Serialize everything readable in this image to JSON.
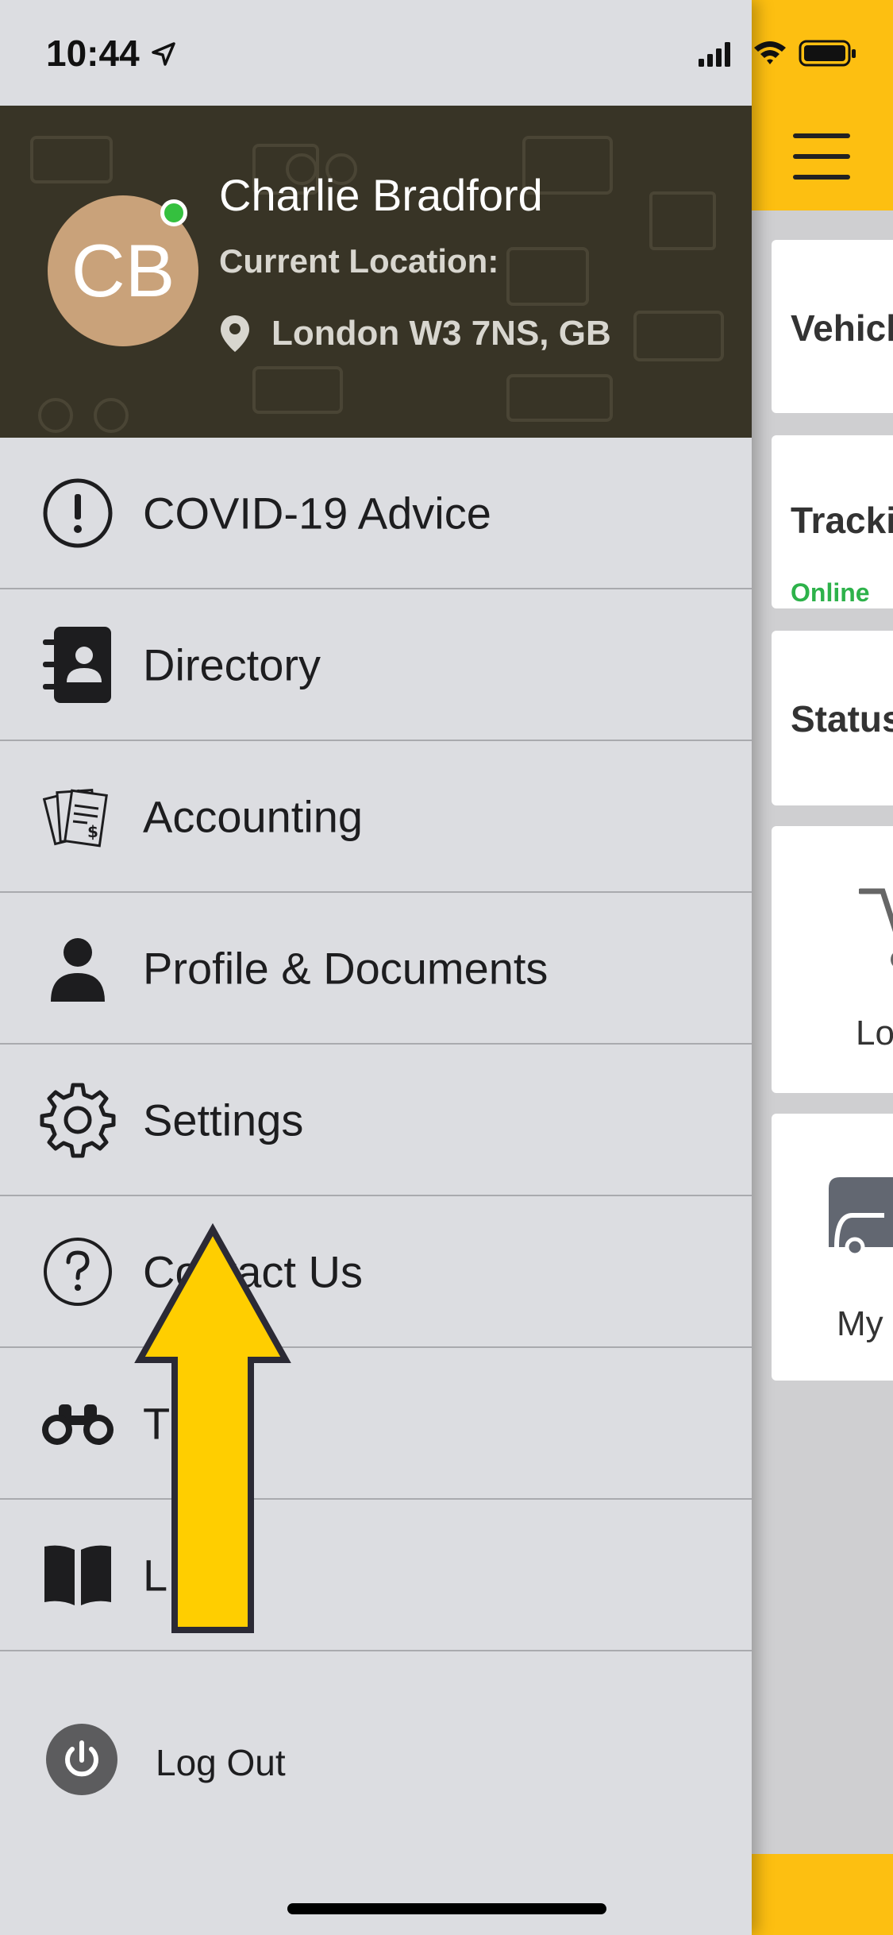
{
  "status_bar": {
    "time": "10:44"
  },
  "profile": {
    "initials": "CB",
    "name": "Charlie Bradford",
    "location_label": "Current Location:",
    "location_value": "London W3 7NS, GB"
  },
  "menu": {
    "items": [
      {
        "label": "COVID-19 Advice",
        "icon": "exclamation-circle-icon"
      },
      {
        "label": "Directory",
        "icon": "contact-book-icon"
      },
      {
        "label": "Accounting",
        "icon": "receipts-icon"
      },
      {
        "label": "Profile & Documents",
        "icon": "person-icon"
      },
      {
        "label": "Settings",
        "icon": "gear-icon"
      },
      {
        "label": "Contact Us",
        "icon": "question-circle-icon"
      },
      {
        "label": "T",
        "icon": "binoculars-icon"
      },
      {
        "label": "L",
        "icon": "book-icon"
      }
    ],
    "logout_label": "Log Out"
  },
  "background_app": {
    "cards": [
      {
        "label": "Vehicl"
      },
      {
        "label": "Trackii",
        "status": "Online"
      },
      {
        "label": "Status"
      },
      {
        "caption": "Lo"
      },
      {
        "caption": "My"
      }
    ]
  },
  "colors": {
    "accent_yellow": "#fdbf11",
    "profile_bg": "#383426",
    "online_green": "#35c03f",
    "drawer_bg": "#dcdde1"
  }
}
